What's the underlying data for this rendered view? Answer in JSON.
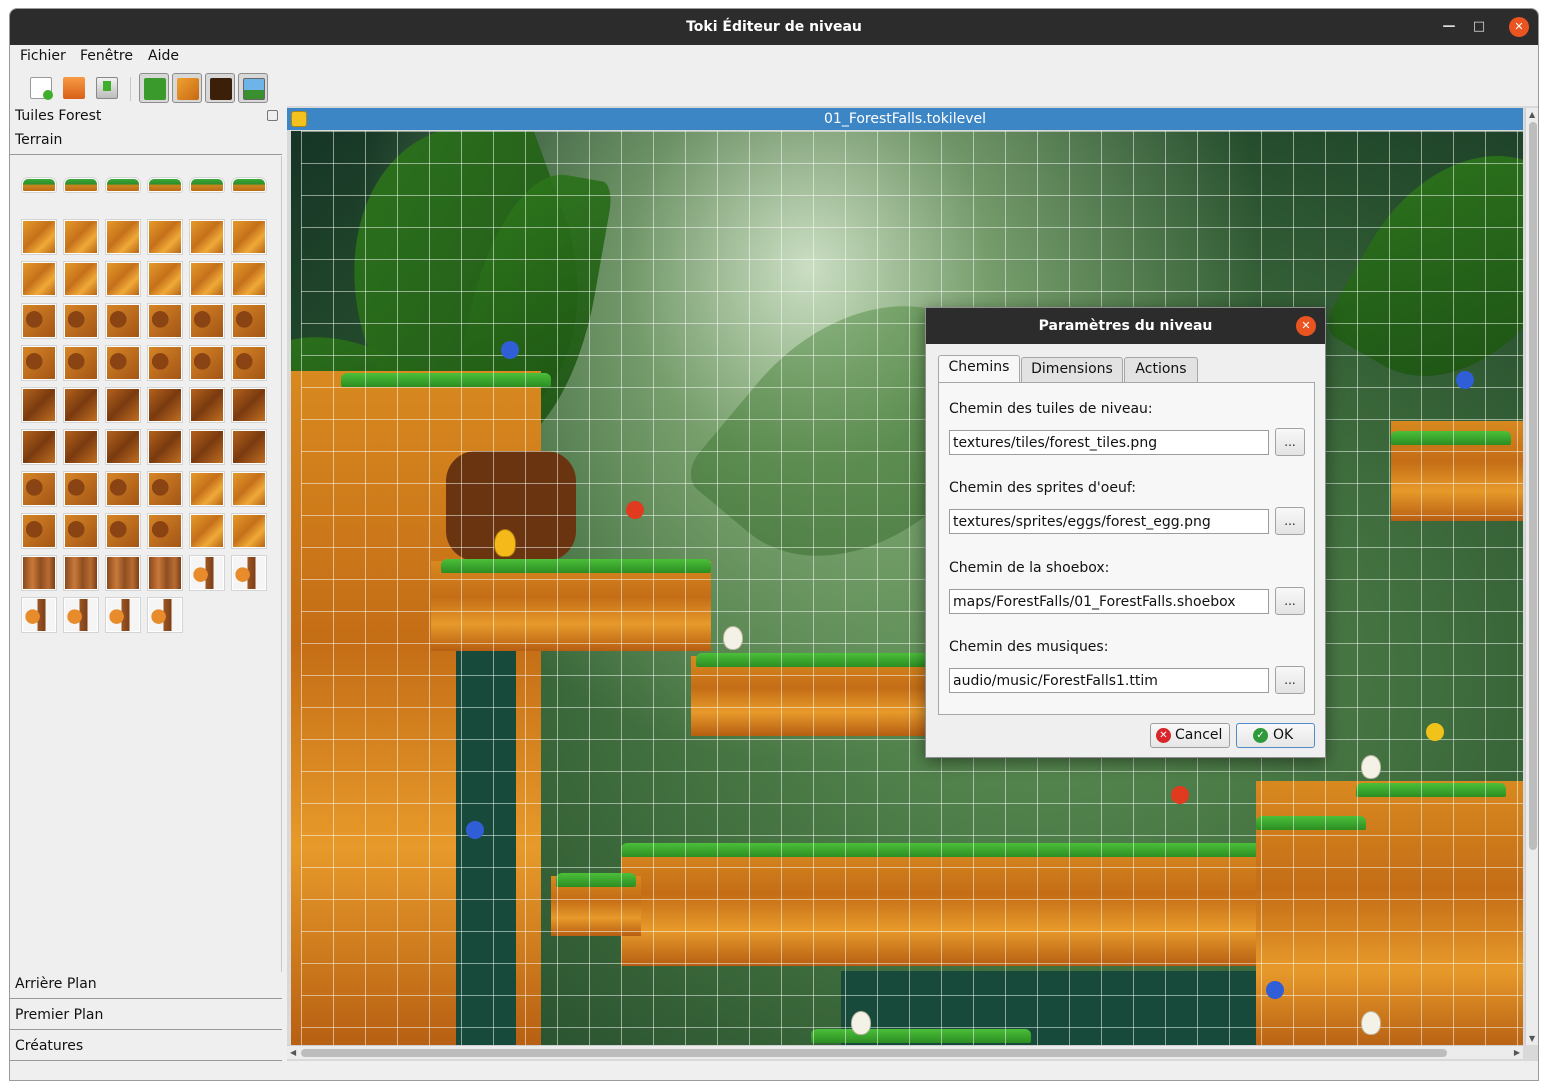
{
  "window": {
    "title": "Toki Éditeur de niveau"
  },
  "menu": {
    "items": [
      "Fichier",
      "Fenêtre",
      "Aide"
    ]
  },
  "toolbar": {
    "buttons": [
      "new-file-icon",
      "open-folder-icon",
      "save-download-icon",
      "terrain-layer-icon",
      "ground-layer-icon",
      "background-layer-icon",
      "level-image-icon"
    ]
  },
  "dock": {
    "title": "Tuiles Forest",
    "pages": [
      "Terrain",
      "Arrière Plan",
      "Premier Plan",
      "Créatures"
    ]
  },
  "document": {
    "title": "01_ForestFalls.tokilevel"
  },
  "dialog": {
    "title": "Paramètres du niveau",
    "tabs": [
      "Chemins",
      "Dimensions",
      "Actions"
    ],
    "fields": [
      {
        "label": "Chemin des tuiles de niveau:",
        "value": "textures/tiles/forest_tiles.png"
      },
      {
        "label": "Chemin des sprites d'oeuf:",
        "value": "textures/sprites/eggs/forest_egg.png"
      },
      {
        "label": "Chemin de la shoebox:",
        "value": "maps/ForestFalls/01_ForestFalls.shoebox"
      },
      {
        "label": "Chemin des musiques:",
        "value": "audio/music/ForestFalls1.ttim"
      }
    ],
    "browse_label": "...",
    "cancel_label": "Cancel",
    "ok_label": "OK"
  },
  "colors": {
    "title_bar": "#2c2c2c",
    "close_button": "#e95420",
    "document_title": "#3d86c6"
  }
}
